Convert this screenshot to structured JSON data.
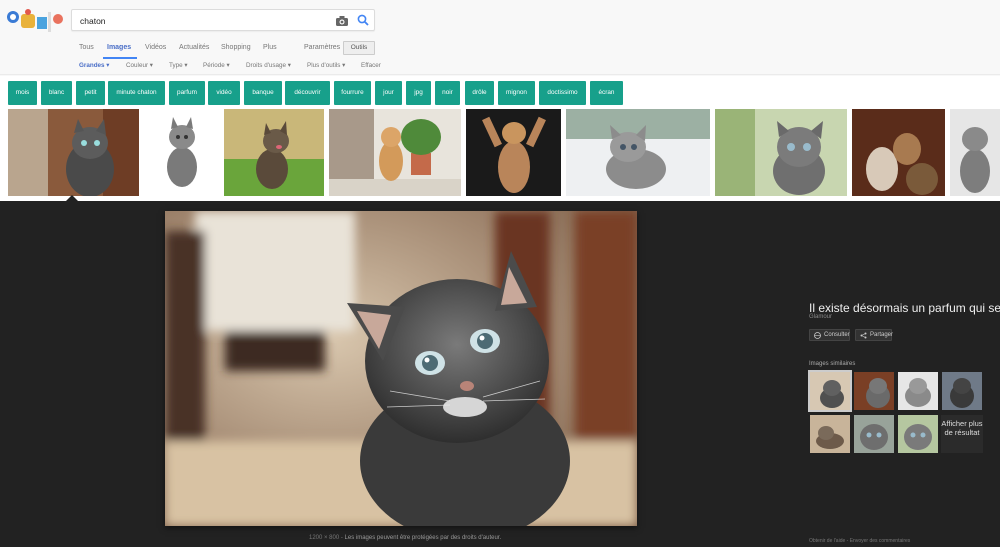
{
  "search": {
    "query": "chaton"
  },
  "tabs": [
    "Tous",
    "Images",
    "Vidéos",
    "Actualités",
    "Shopping",
    "Plus",
    "Paramètres"
  ],
  "tools_label": "Outils",
  "filters": [
    "Grandes ▾",
    "Couleur ▾",
    "Type ▾",
    "Période ▾",
    "Droits d'usage ▾",
    "Plus d'outils ▾",
    "Effacer"
  ],
  "chips": [
    "mois",
    "blanc",
    "petit",
    "minute chaton",
    "parfum",
    "vidéo",
    "banque",
    "découvrir",
    "fourrure",
    "jour",
    "jpg",
    "noir",
    "drôle",
    "mignon",
    "doctissimo",
    "écran"
  ],
  "viewer": {
    "caption_dim": "1200 × 800",
    "caption_sep": " - ",
    "caption_text": "Les images peuvent être protégées par des droits d'auteur.",
    "title": "Il existe désormais un parfum qui sent la",
    "source": "Glamour",
    "visit_label": "Consulter",
    "share_label": "Partager",
    "similar_label": "Images similaires",
    "more_results": "Afficher plus de résultat",
    "footer_help": "Obtenir de l'aide",
    "footer_sep": " - ",
    "footer_feedback": "Envoyer des commentaires"
  },
  "colors": {
    "chip": "#17a08b",
    "accent": "#4285f4",
    "viewer_bg": "#222222"
  }
}
